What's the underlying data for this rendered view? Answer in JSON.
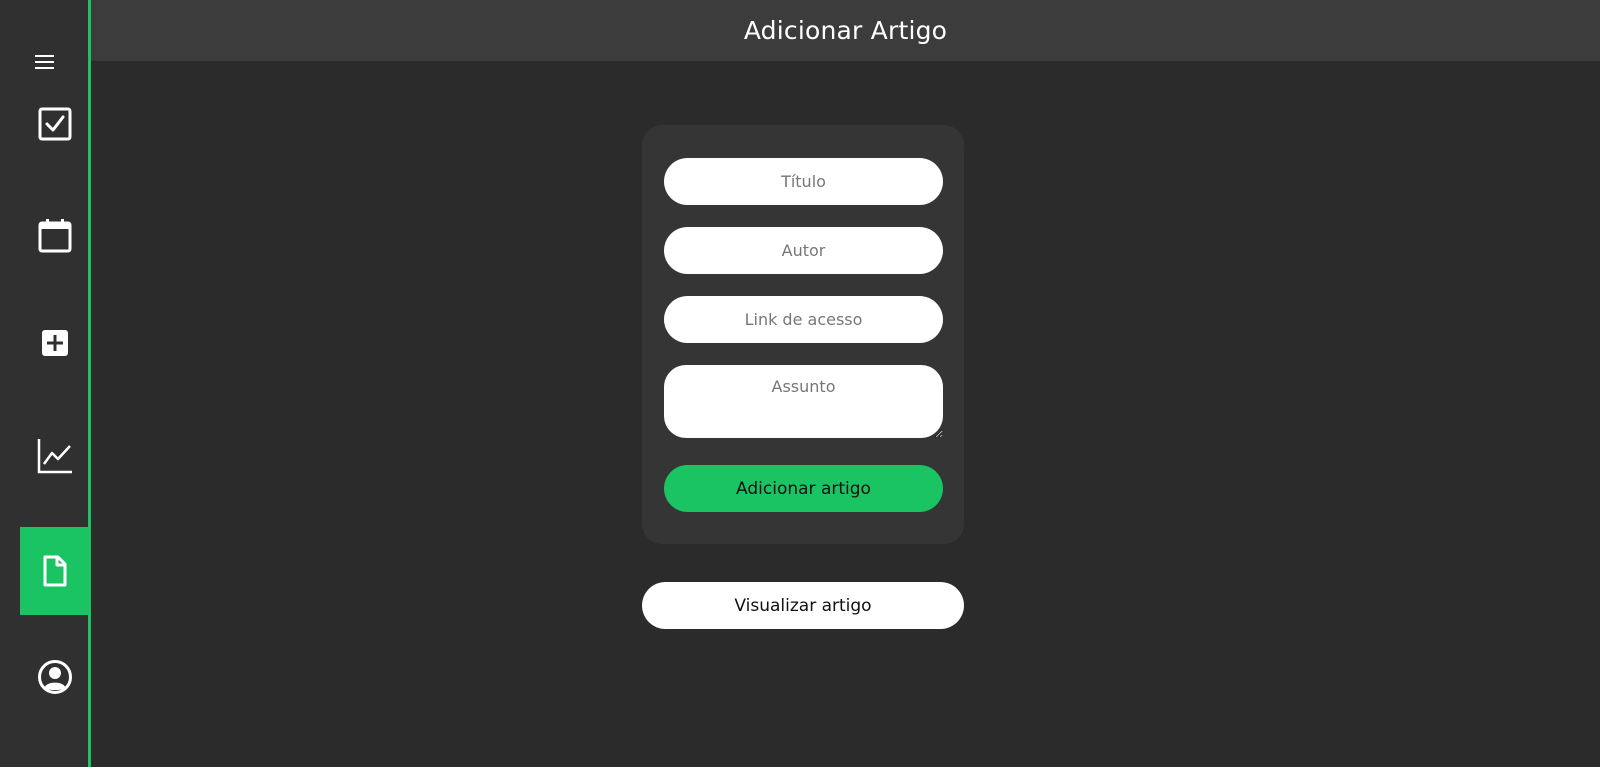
{
  "header": {
    "title": "Adicionar Artigo"
  },
  "sidebar": {
    "menu_icon": "hamburger-menu-icon",
    "items": [
      {
        "name": "tasks",
        "icon": "checkbox-icon",
        "active": false
      },
      {
        "name": "calendar",
        "icon": "calendar-icon",
        "active": false
      },
      {
        "name": "add",
        "icon": "plus-square-icon",
        "active": false
      },
      {
        "name": "stats",
        "icon": "line-chart-icon",
        "active": false
      },
      {
        "name": "articles",
        "icon": "document-icon",
        "active": true
      },
      {
        "name": "profile",
        "icon": "user-circle-icon",
        "active": false
      }
    ]
  },
  "form": {
    "title_placeholder": "Título",
    "author_placeholder": "Autor",
    "link_placeholder": "Link de acesso",
    "subject_placeholder": "Assunto",
    "submit_label": "Adicionar artigo"
  },
  "view_button_label": "Visualizar artigo",
  "colors": {
    "accent": "#1bc463",
    "background": "#2b2b2b",
    "sidebar": "#303030",
    "header": "#3c3c3c",
    "card": "#353535"
  }
}
